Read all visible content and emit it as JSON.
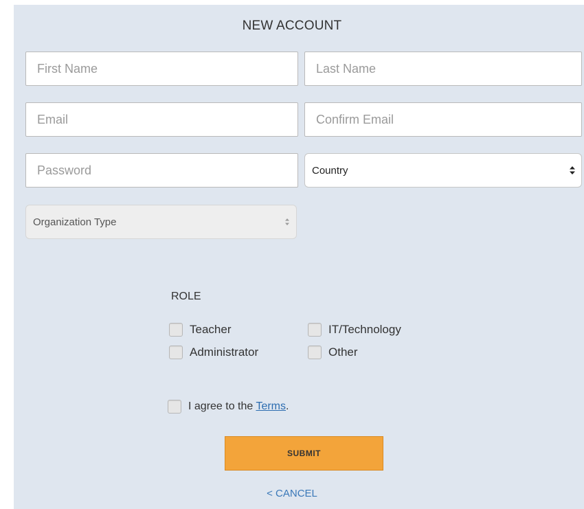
{
  "form": {
    "title": "NEW ACCOUNT",
    "first_name": {
      "placeholder": "First Name",
      "value": ""
    },
    "last_name": {
      "placeholder": "Last Name",
      "value": ""
    },
    "email": {
      "placeholder": "Email",
      "value": ""
    },
    "confirm_email": {
      "placeholder": "Confirm Email",
      "value": ""
    },
    "password": {
      "placeholder": "Password",
      "value": ""
    },
    "country": {
      "selected": "Country"
    },
    "organization_type": {
      "selected": "Organization Type"
    }
  },
  "role": {
    "label": "ROLE",
    "options": [
      "Teacher",
      "IT/Technology",
      "Administrator",
      "Other"
    ]
  },
  "agree": {
    "prefix": "I agree to the ",
    "link": "Terms",
    "suffix": "."
  },
  "submit_label": "SUBMIT",
  "cancel_label": "< CANCEL",
  "colors": {
    "panel_bg": "#dfe6ef",
    "submit_bg": "#f3a43a",
    "link": "#2b6cb0"
  },
  "icons": {
    "select_arrows": "up-down-chevron-icon"
  }
}
